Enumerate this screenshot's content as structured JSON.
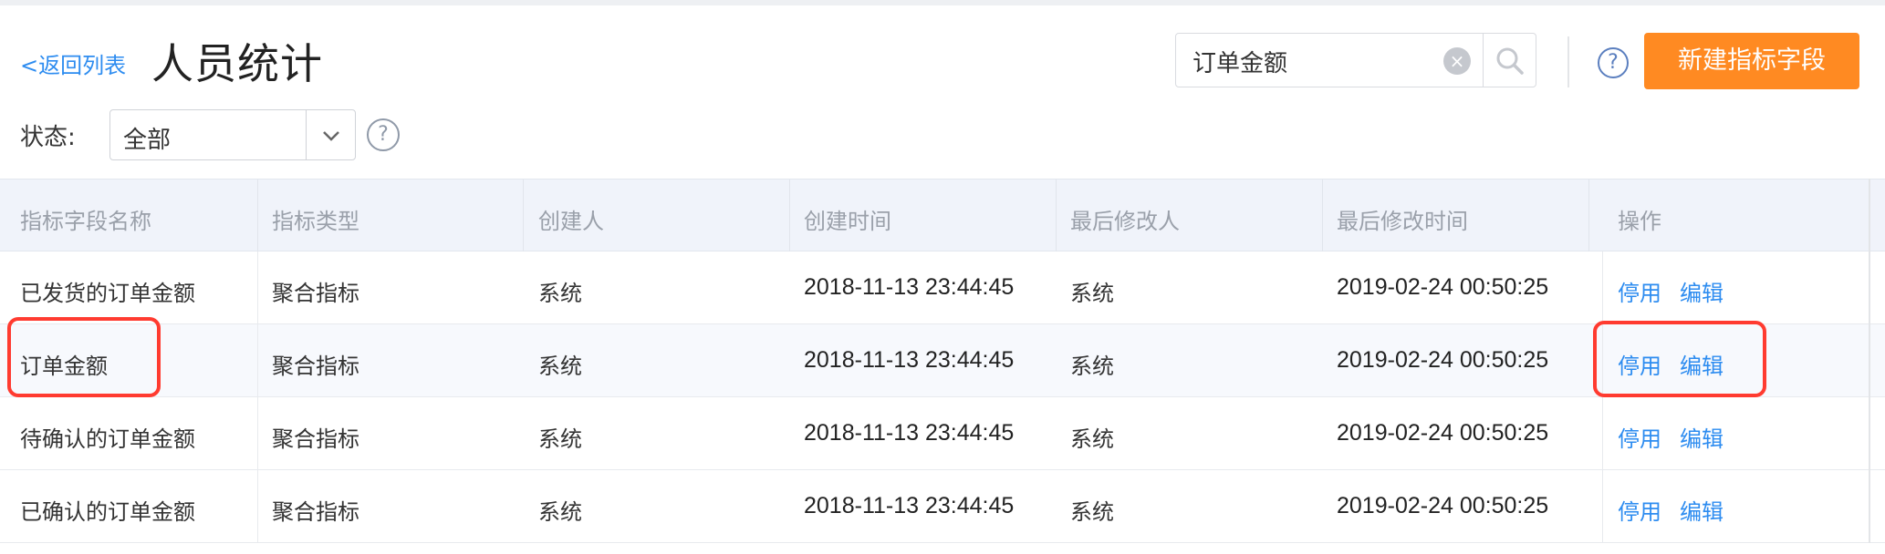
{
  "header": {
    "back_label": "<返回列表",
    "title": "人员统计"
  },
  "search": {
    "value": "订单金额",
    "placeholder": ""
  },
  "actions": {
    "new_button": "新建指标字段"
  },
  "filter": {
    "status_label": "状态:",
    "status_value": "全部"
  },
  "table": {
    "columns": [
      "指标字段名称",
      "指标类型",
      "创建人",
      "创建时间",
      "最后修改人",
      "最后修改时间",
      "操作"
    ],
    "rows": [
      {
        "name": "已发货的订单金额",
        "type": "聚合指标",
        "creator": "系统",
        "created": "2018-11-13 23:44:45",
        "modifier": "系统",
        "modified": "2019-02-24 00:50:25",
        "disable": "停用",
        "edit": "编辑"
      },
      {
        "name": "订单金额",
        "type": "聚合指标",
        "creator": "系统",
        "created": "2018-11-13 23:44:45",
        "modifier": "系统",
        "modified": "2019-02-24 00:50:25",
        "disable": "停用",
        "edit": "编辑"
      },
      {
        "name": "待确认的订单金额",
        "type": "聚合指标",
        "creator": "系统",
        "created": "2018-11-13 23:44:45",
        "modifier": "系统",
        "modified": "2019-02-24 00:50:25",
        "disable": "停用",
        "edit": "编辑"
      },
      {
        "name": "已确认的订单金额",
        "type": "聚合指标",
        "creator": "系统",
        "created": "2018-11-13 23:44:45",
        "modifier": "系统",
        "modified": "2019-02-24 00:50:25",
        "disable": "停用",
        "edit": "编辑"
      }
    ]
  },
  "colors": {
    "accent": "#2d8cf0",
    "primary_button": "#ff8a22",
    "highlight": "#ff3b30"
  },
  "icons": {
    "search": "search-icon",
    "clear": "clear-icon",
    "help": "help-icon",
    "dropdown": "chevron-down-icon"
  }
}
